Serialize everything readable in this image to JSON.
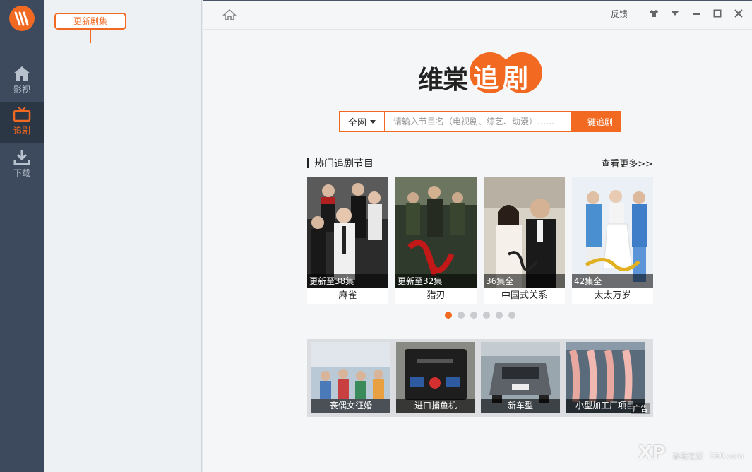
{
  "sidebar": {
    "items": [
      {
        "label": "影视",
        "icon": "home-icon"
      },
      {
        "label": "追剧",
        "icon": "tv-icon"
      },
      {
        "label": "下载",
        "icon": "download-icon"
      }
    ],
    "active_index": 1
  },
  "panel": {
    "update_label": "更新剧集"
  },
  "topbar": {
    "feedback_label": "反馈",
    "controls": [
      "shirt-icon",
      "dropdown-icon",
      "minimize-icon",
      "maximize-icon",
      "close-icon"
    ]
  },
  "brand": {
    "text": "维棠",
    "accent": "追剧"
  },
  "search": {
    "scope": "全网",
    "placeholder": "请输入节目名（电视剧、综艺、动漫）……",
    "button_label": "一键追剧"
  },
  "hot": {
    "title": "热门追剧节目",
    "more_label": "查看更多>>",
    "shows": [
      {
        "title": "麻雀",
        "status": "更新至38集"
      },
      {
        "title": "猎刃",
        "status": "更新至32集"
      },
      {
        "title": "中国式关系",
        "status": "36集全"
      },
      {
        "title": "太太万岁",
        "status": "42集全"
      }
    ],
    "page_count": 6,
    "active_page": 0
  },
  "ads": {
    "items": [
      {
        "caption": "丧偶女征婚"
      },
      {
        "caption": "进口捕鱼机"
      },
      {
        "caption": "新车型"
      },
      {
        "caption": "小型加工厂项目"
      }
    ],
    "label": "广告"
  },
  "watermark": {
    "text": "XP",
    "sub": "系统之家",
    "domain": "510.com"
  },
  "colors": {
    "accent": "#f26a21",
    "rail": "#3d4a5d"
  }
}
